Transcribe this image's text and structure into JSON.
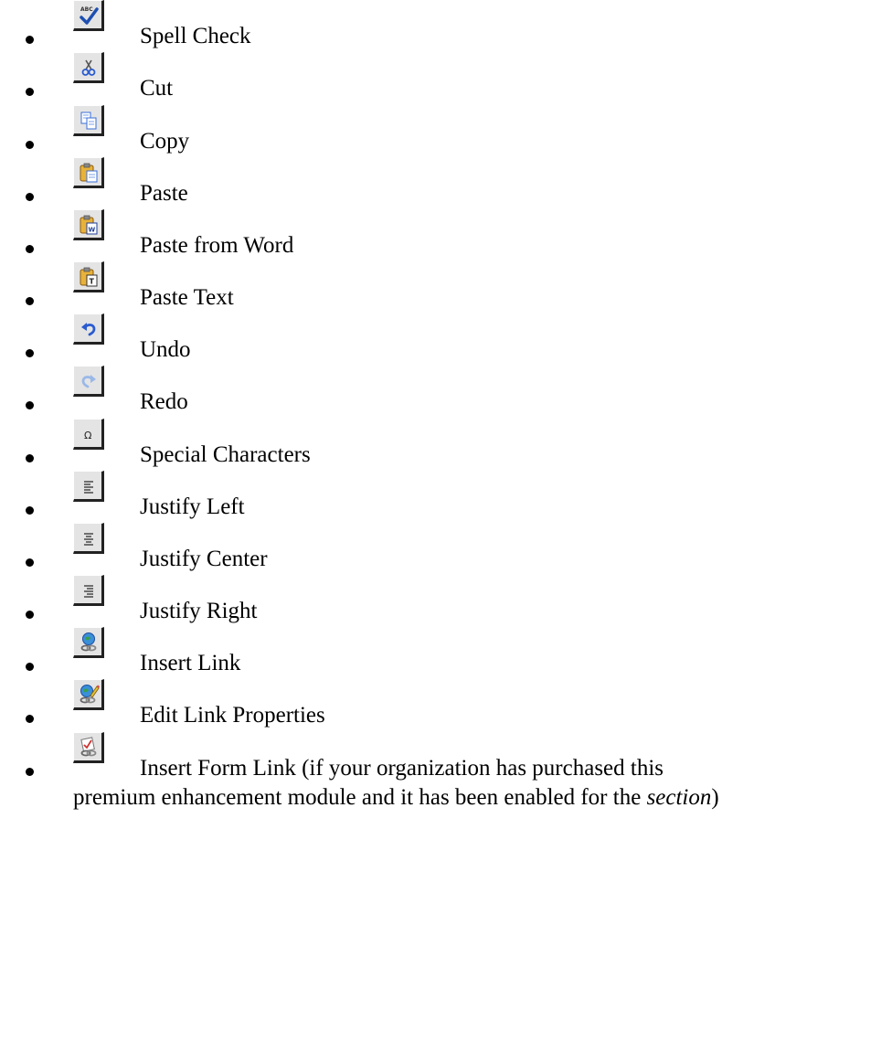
{
  "toolbar_items": [
    {
      "icon": "spell-check-icon",
      "label": "Spell Check"
    },
    {
      "icon": "cut-icon",
      "label": "Cut"
    },
    {
      "icon": "copy-icon",
      "label": "Copy"
    },
    {
      "icon": "paste-icon",
      "label": "Paste"
    },
    {
      "icon": "paste-from-word-icon",
      "label": "Paste from Word"
    },
    {
      "icon": "paste-text-icon",
      "label": "Paste Text"
    },
    {
      "icon": "undo-icon",
      "label": "Undo"
    },
    {
      "icon": "redo-icon",
      "label": "Redo"
    },
    {
      "icon": "special-characters-icon",
      "label": "Special Characters"
    },
    {
      "icon": "justify-left-icon",
      "label": "Justify Left"
    },
    {
      "icon": "justify-center-icon",
      "label": "Justify Center"
    },
    {
      "icon": "justify-right-icon",
      "label": "Justify Right"
    },
    {
      "icon": "insert-link-icon",
      "label": "Insert Link"
    },
    {
      "icon": "edit-link-properties-icon",
      "label": "Edit Link Properties"
    },
    {
      "icon": "insert-form-link-icon",
      "label": "Insert Form Link (if your organization has purchased this",
      "label_cont_before": "premium enhancement module and it has been enabled for the ",
      "label_cont_em": "section",
      "label_cont_after": ")"
    }
  ]
}
